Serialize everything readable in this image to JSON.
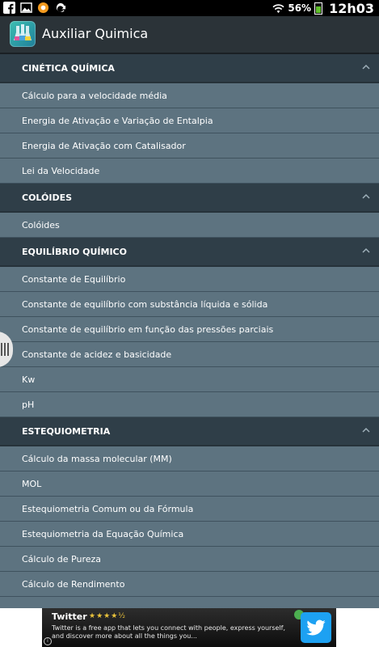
{
  "status_bar": {
    "battery_percent": "56%",
    "time": "12h03",
    "icons": [
      "facebook-icon",
      "gallery-icon",
      "notification-app-icon",
      "sync-icon",
      "wifi-icon",
      "battery-icon"
    ]
  },
  "app": {
    "title": "Auxiliar Quimica",
    "icon": "app-icon-flasks"
  },
  "sections": [
    {
      "title": "CINÉTICA QUÍMICA",
      "items": [
        "Cálculo para a velocidade média",
        "Energia de Ativação e Variação de Entalpia",
        "Energia de Ativação com Catalisador",
        "Lei da Velocidade"
      ]
    },
    {
      "title": "COLÓIDES",
      "items": [
        "Colóides"
      ]
    },
    {
      "title": "EQUILÍBRIO QUÍMICO",
      "items": [
        "Constante de Equilíbrio",
        "Constante de equilíbrio com substância líquida e sólida",
        "Constante de equilíbrio em função das pressões parciais",
        "Constante de acidez e basicidade",
        "Kw",
        "pH"
      ]
    },
    {
      "title": "ESTEQUIOMETRIA",
      "items": [
        "Cálculo da massa molecular (MM)",
        "MOL",
        "Estequiometria Comum ou da Fórmula",
        "Estequiometria da Equação Química",
        "Cálculo de Pureza",
        "Cálculo de Rendimento"
      ]
    }
  ],
  "ad": {
    "title": "Twitter",
    "stars": "★★★★½",
    "description": "Twitter is a free app that lets you connect with people, express yourself, and discover more about all the things you...",
    "logo_icon": "twitter-bird-icon",
    "info_label": "i"
  },
  "colors": {
    "item_bg": "#5d7380",
    "header_bg": "#2f3e48",
    "actionbar_bg": "#2b3338",
    "twitter_blue": "#1da1f2"
  }
}
